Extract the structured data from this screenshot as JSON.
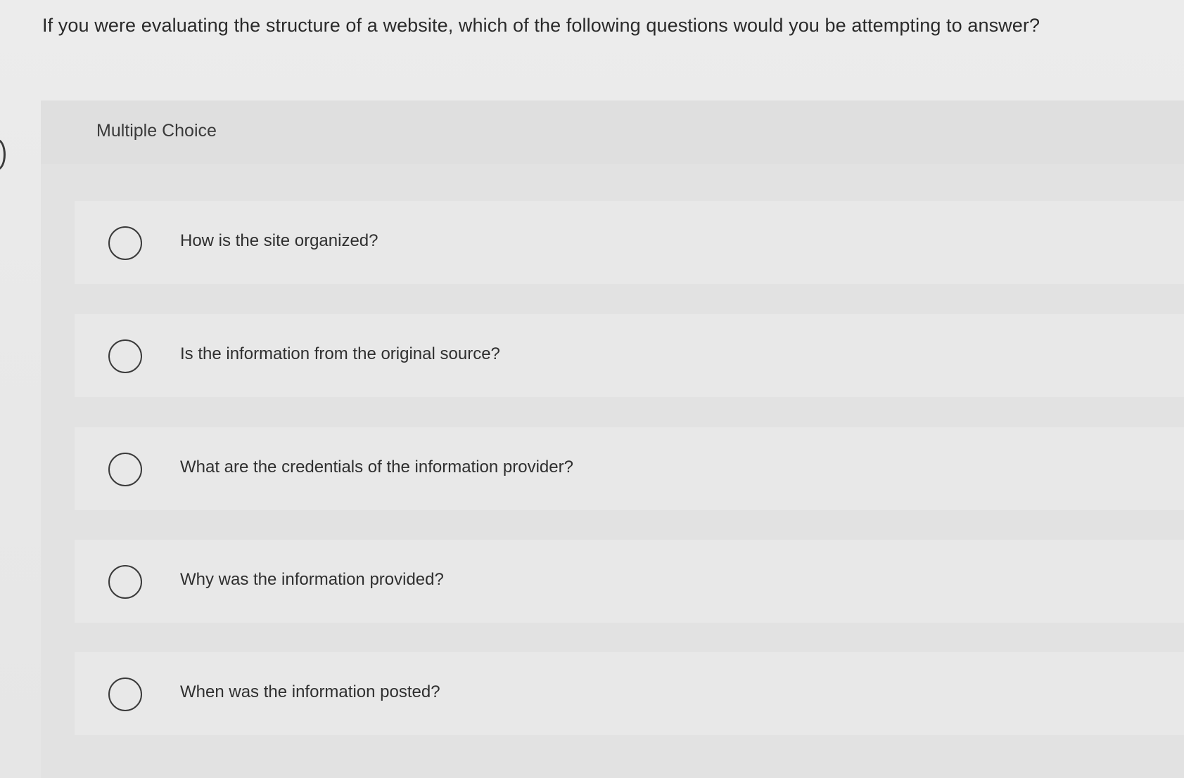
{
  "question": {
    "text": "If you were evaluating the structure of a website, which of the following questions would you be attempting to answer?"
  },
  "multiple_choice": {
    "label": "Multiple Choice",
    "options": [
      {
        "label": "How is the site organized?",
        "icon": "radio-unchecked-icon"
      },
      {
        "label": "Is the information from the original source?",
        "icon": "radio-unchecked-icon"
      },
      {
        "label": "What are the credentials of the information provider?",
        "icon": "radio-unchecked-icon"
      },
      {
        "label": "Why was the information provided?",
        "icon": "radio-unchecked-icon"
      },
      {
        "label": "When was the information posted?",
        "icon": "radio-unchecked-icon"
      }
    ]
  },
  "colors": {
    "background": "#ebebeb",
    "panel": "#e2e2e2",
    "option_row": "#e8e8e8",
    "text": "#2f2f2f",
    "radio_border": "#3a3a3a"
  }
}
